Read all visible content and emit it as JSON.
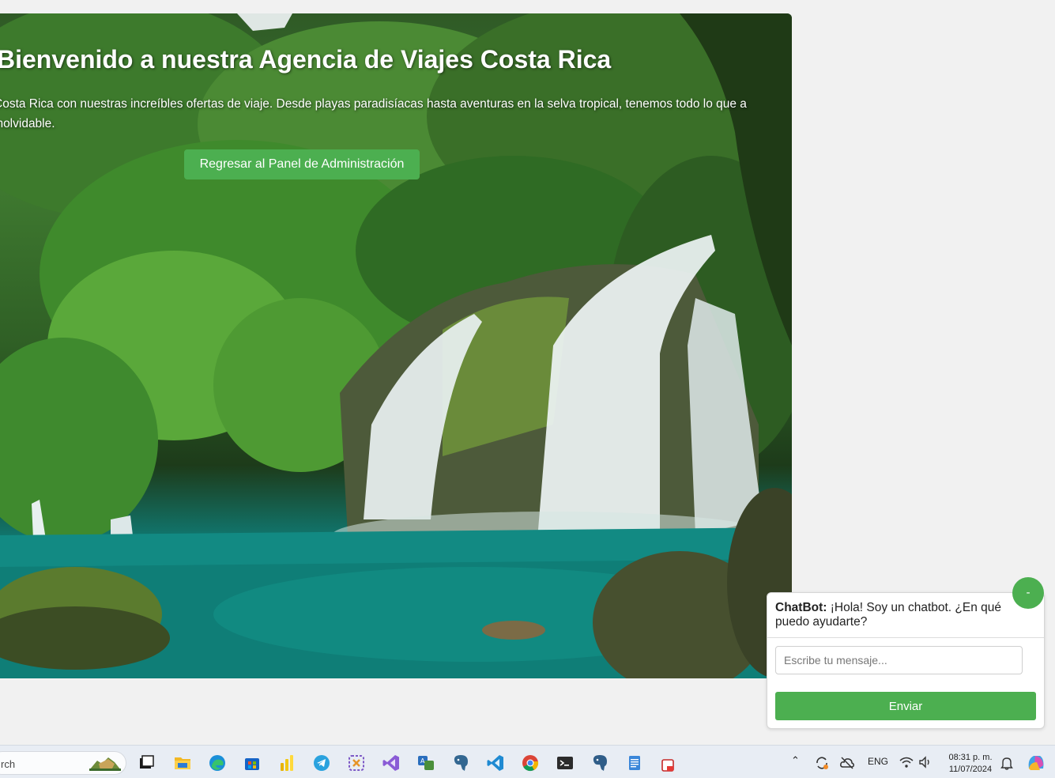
{
  "hero": {
    "title": "Bienvenido a nuestra Agencia de Viajes Costa Rica",
    "description": "Costa Rica con nuestras increíbles ofertas de viaje. Desde playas paradisíacas hasta aventuras en la selva tropical, tenemos todo lo que a inolvidable.",
    "admin_button": "Regresar al Panel de Administración",
    "background": "waterfall-jungle-photo"
  },
  "chatbot": {
    "sender": "ChatBot:",
    "greeting": "¡Hola! Soy un chatbot. ¿En qué puedo ayudarte?",
    "input_placeholder": "Escribe tu mensaje...",
    "send_label": "Enviar",
    "minimize_label": "-",
    "accent": "#4caf50"
  },
  "taskbar": {
    "search_text": "rch",
    "apps": [
      "task-view-icon",
      "file-explorer-icon",
      "edge-icon",
      "store-icon",
      "power-bi-icon",
      "telegram-icon",
      "snipping-tool-icon",
      "visual-studio-icon",
      "translator-icon",
      "postgres-icon",
      "vscode-icon",
      "chrome-icon",
      "terminal-icon",
      "pgadmin-icon",
      "notepad-icon",
      "app-icon"
    ],
    "tray": {
      "language": "ENG",
      "time": "08:31 p. m.",
      "date": "11/07/2024"
    }
  }
}
